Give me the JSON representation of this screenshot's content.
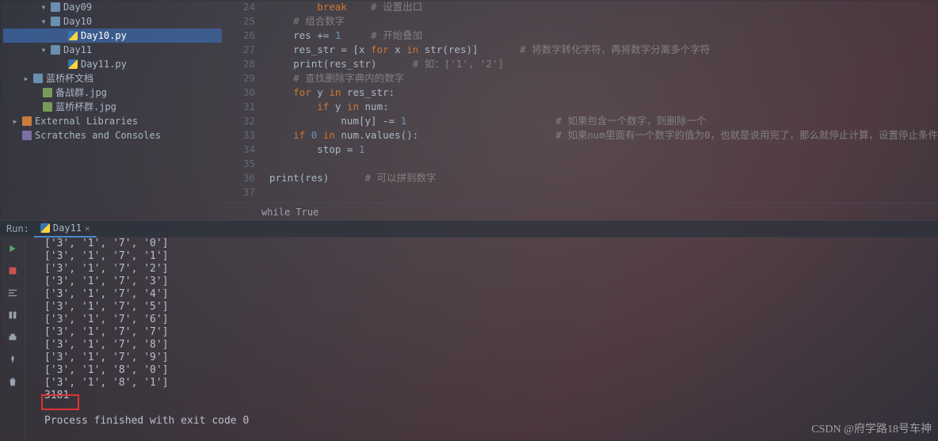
{
  "tree": {
    "items": [
      {
        "indent": 42,
        "tw": "▾",
        "ico": "dir",
        "label": "Day09"
      },
      {
        "indent": 42,
        "tw": "▾",
        "ico": "dir",
        "label": "Day10",
        "selected": false
      },
      {
        "indent": 64,
        "tw": "",
        "ico": "py",
        "label": "Day10.py",
        "selected": true
      },
      {
        "indent": 42,
        "tw": "▾",
        "ico": "dir",
        "label": "Day11"
      },
      {
        "indent": 64,
        "tw": "",
        "ico": "py",
        "label": "Day11.py"
      },
      {
        "indent": 20,
        "tw": "▸",
        "ico": "dir",
        "label": "蓝桥杯文档"
      },
      {
        "indent": 32,
        "tw": "",
        "ico": "img",
        "label": "备战群.jpg"
      },
      {
        "indent": 32,
        "tw": "",
        "ico": "img",
        "label": "蓝桥杯群.jpg"
      },
      {
        "indent": 6,
        "tw": "▸",
        "ico": "lib",
        "label": "External Libraries"
      },
      {
        "indent": 6,
        "tw": "",
        "ico": "scr",
        "label": "Scratches and Consoles"
      }
    ]
  },
  "editor": {
    "first_line": 24,
    "lines": [
      {
        "n": 24,
        "html": "        <span class='kw'>break</span>    <span class='cmt'># 设置出口</span>"
      },
      {
        "n": 25,
        "html": "    <span class='cmt'># 组合数字</span>"
      },
      {
        "n": 26,
        "html": "    <span class='fn'>res</span> += <span class='num'>1</span>     <span class='cmt'># 开始叠加</span>"
      },
      {
        "n": 27,
        "html": "    <span class='fn'>res_str</span> = [<span class='fn'>x</span> <span class='kw'>for</span> <span class='fn'>x</span> <span class='kw'>in</span> <span class='fn'>str</span>(<span class='fn'>res</span>)]       <span class='cmt'># 将数字转化字符，再将数字分离多个字符</span>"
      },
      {
        "n": 28,
        "html": "    <span class='fn'>print</span>(<span class='fn'>res_str</span>)      <span class='cmt'># 如：['1', '2']</span>"
      },
      {
        "n": 29,
        "html": "    <span class='cmt'># 查找删除字典内的数字</span>"
      },
      {
        "n": 30,
        "html": "    <span class='kw'>for</span> <span class='fn'>y</span> <span class='kw'>in</span> <span class='fn'>res_str</span>:"
      },
      {
        "n": 31,
        "html": "        <span class='kw'>if</span> <span class='fn'>y</span> <span class='kw'>in</span> <span class='fn'>num</span>:"
      },
      {
        "n": 32,
        "html": "            <span class='fn'>num</span>[<span class='fn'>y</span>] -= <span class='num'>1</span>                         <span class='cmt'># 如果包含一个数字，则删除一个</span>"
      },
      {
        "n": 33,
        "html": "    <span class='kw'>if</span> <span class='num'>0</span> <span class='kw'>in</span> <span class='fn'>num</span>.<span class='fn'>values</span>():                       <span class='cmt'># 如果num里面有一个数字的值为0，也就是说用完了，那么就停止计算，设置停止条件</span>"
      },
      {
        "n": 34,
        "html": "        <span class='fn'>stop</span> = <span class='num'>1</span>"
      },
      {
        "n": 35,
        "html": ""
      },
      {
        "n": 36,
        "html": "<span class='fn'>print</span>(<span class='fn'>res</span>)      <span class='cmt'># 可以拼到数字</span>"
      },
      {
        "n": 37,
        "html": ""
      }
    ],
    "breadcrumb": "while True"
  },
  "run": {
    "label": "Run:",
    "tab": "Day11",
    "output": [
      "['3', '1', '7', '0']",
      "['3', '1', '7', '1']",
      "['3', '1', '7', '2']",
      "['3', '1', '7', '3']",
      "['3', '1', '7', '4']",
      "['3', '1', '7', '5']",
      "['3', '1', '7', '6']",
      "['3', '1', '7', '7']",
      "['3', '1', '7', '8']",
      "['3', '1', '7', '9']",
      "['3', '1', '8', '0']",
      "['3', '1', '8', '1']",
      "3181",
      "",
      "Process finished with exit code 0"
    ]
  },
  "watermark": "CSDN @府学路18号车神"
}
